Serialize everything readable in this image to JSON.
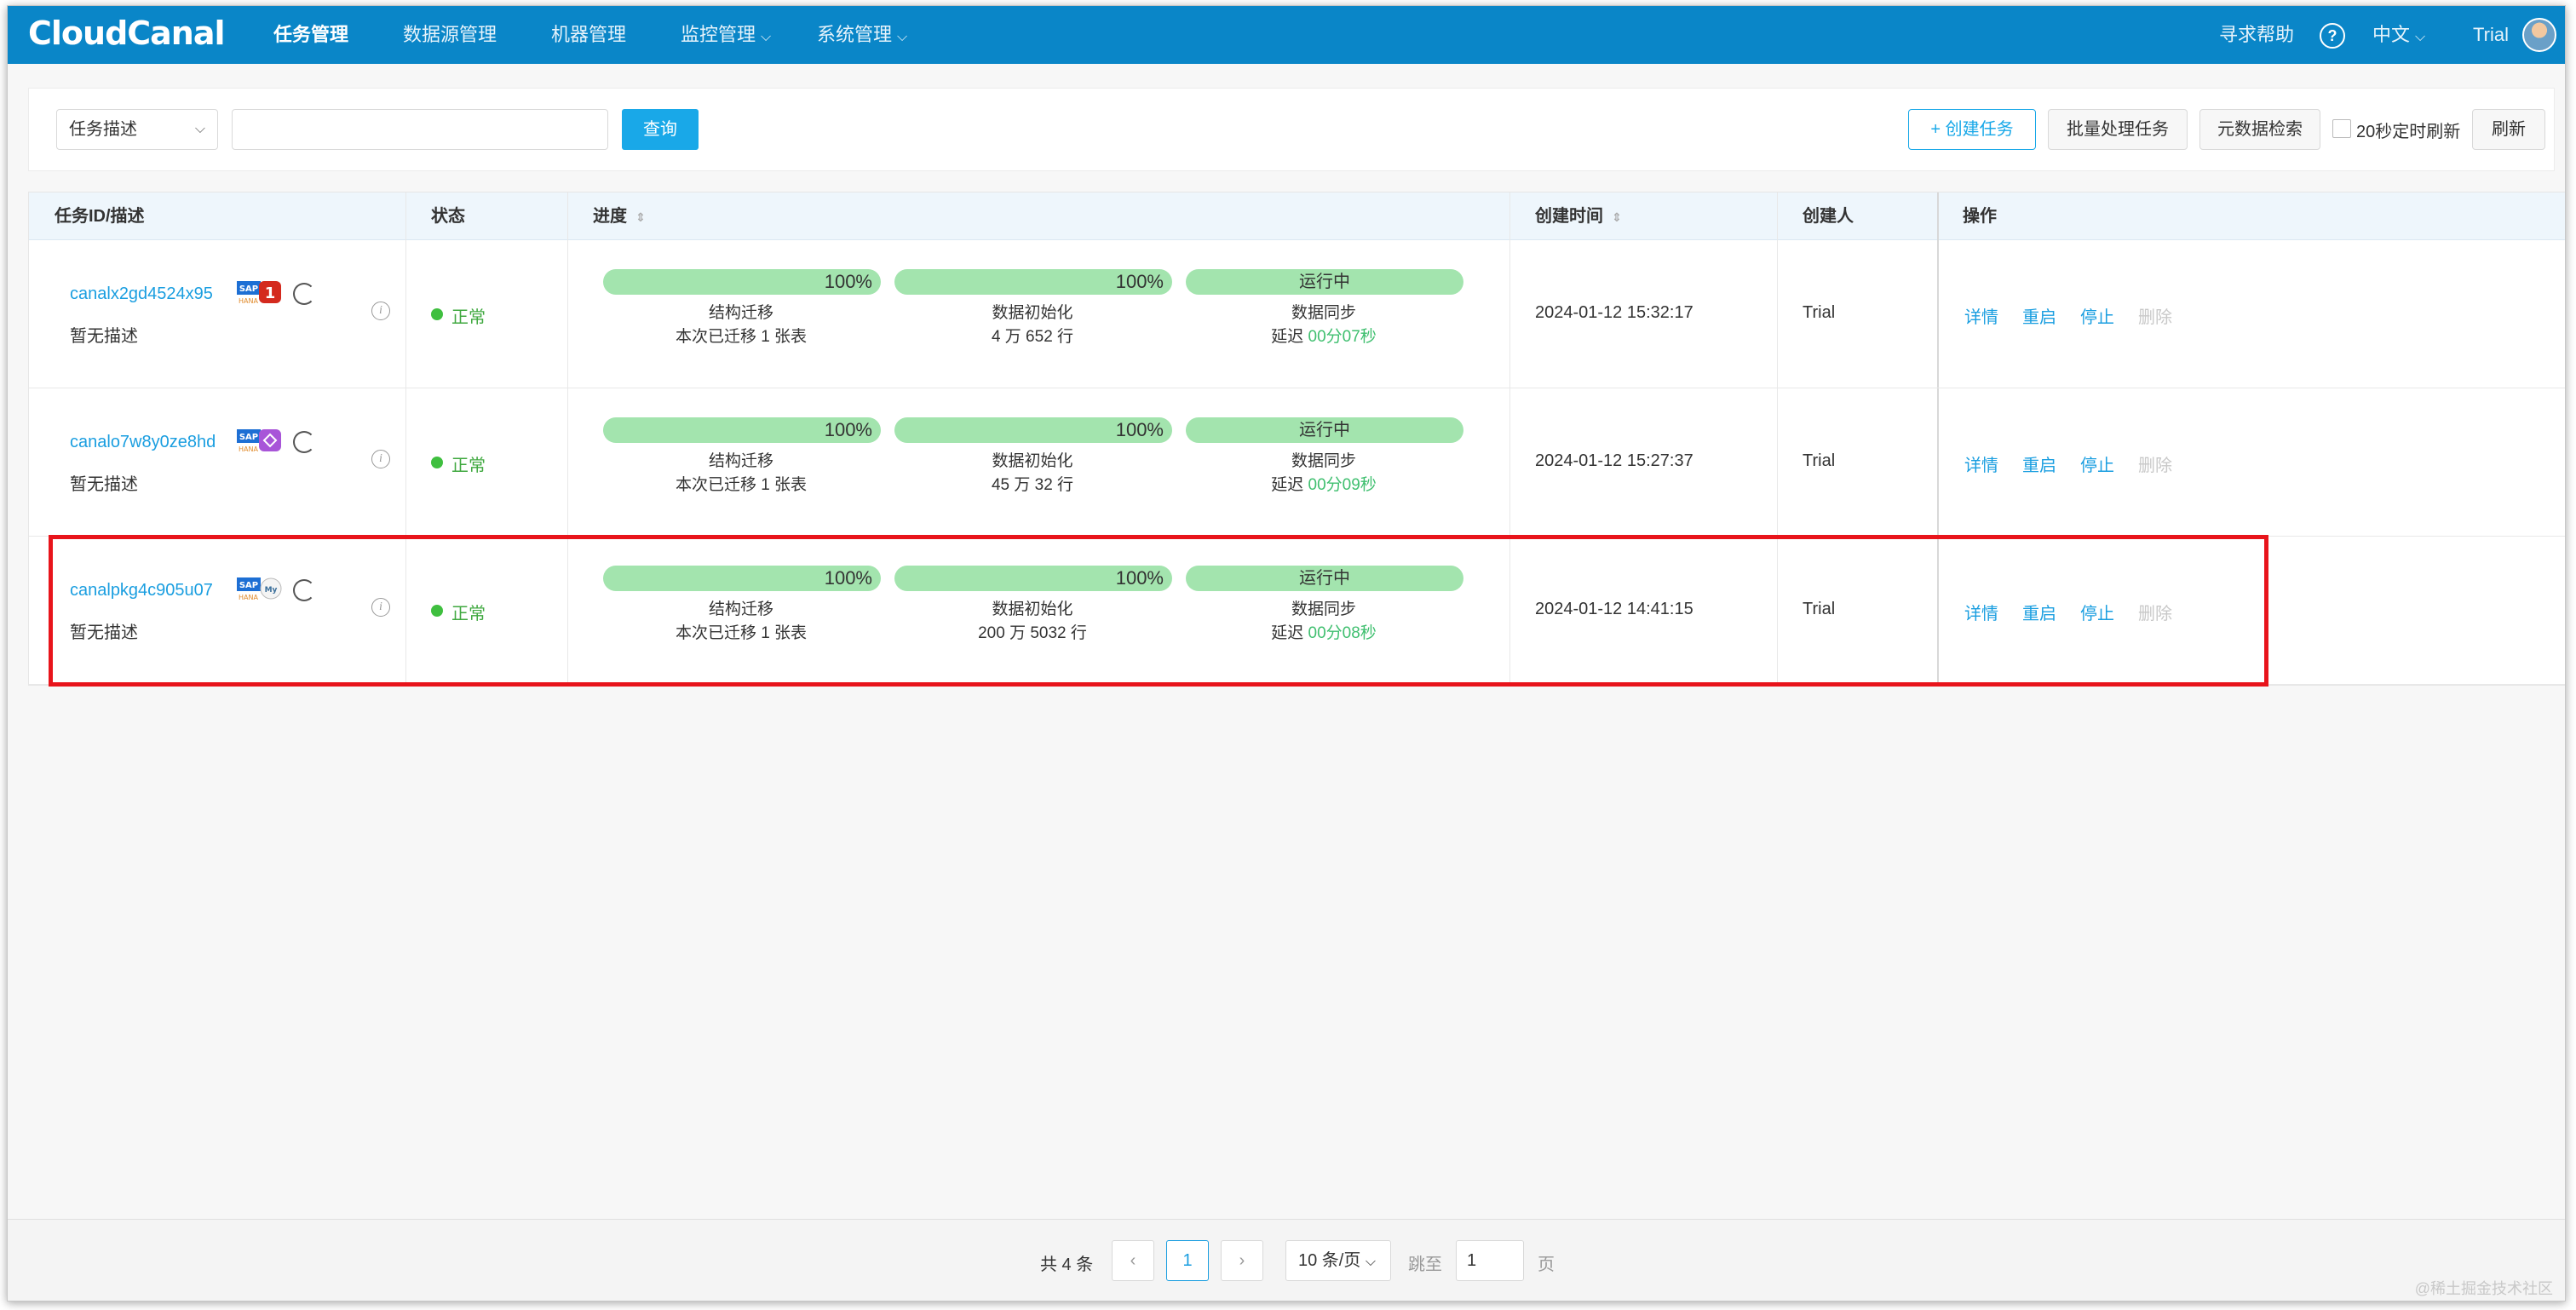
{
  "app": {
    "logo": "CloudCanal"
  },
  "nav": {
    "items": [
      {
        "label": "任务管理",
        "active": true,
        "dropdown": false
      },
      {
        "label": "数据源管理",
        "active": false,
        "dropdown": false
      },
      {
        "label": "机器管理",
        "active": false,
        "dropdown": false
      },
      {
        "label": "监控管理",
        "active": false,
        "dropdown": true
      },
      {
        "label": "系统管理",
        "active": false,
        "dropdown": true
      }
    ],
    "help": "寻求帮助",
    "language": "中文",
    "user": "Trial"
  },
  "filter": {
    "select_value": "任务描述",
    "search_value": "",
    "query_button": "查询",
    "create_button": "+ 创建任务",
    "batch_button": "批量处理任务",
    "meta_search_button": "元数据检索",
    "auto_refresh_label": "20秒定时刷新",
    "auto_refresh_checked": false,
    "refresh_button": "刷新"
  },
  "table": {
    "columns": [
      "任务ID/描述",
      "状态",
      "进度",
      "创建时间",
      "创建人",
      "操作"
    ],
    "rows": [
      {
        "id": "canalx2gd4524x95",
        "desc": "暂无描述",
        "target_db": "red-square",
        "status": "正常",
        "struct_pct": "100%",
        "struct_label": "结构迁移",
        "struct_detail": "本次已迁移 1 张表",
        "init_pct": "100%",
        "init_label": "数据初始化",
        "init_detail": "4 万 652 行",
        "sync_status": "运行中",
        "sync_label": "数据同步",
        "sync_delay_prefix": "延迟",
        "sync_delay": "00分07秒",
        "created": "2024-01-12 15:32:17",
        "creator": "Trial",
        "actions": [
          "详情",
          "重启",
          "停止",
          "删除"
        ]
      },
      {
        "id": "canalo7w8y0ze8hd",
        "desc": "暂无描述",
        "target_db": "purple-square",
        "status": "正常",
        "struct_pct": "100%",
        "struct_label": "结构迁移",
        "struct_detail": "本次已迁移 1 张表",
        "init_pct": "100%",
        "init_label": "数据初始化",
        "init_detail": "45 万 32 行",
        "sync_status": "运行中",
        "sync_label": "数据同步",
        "sync_delay_prefix": "延迟",
        "sync_delay": "00分09秒",
        "created": "2024-01-12 15:27:37",
        "creator": "Trial",
        "actions": [
          "详情",
          "重启",
          "停止",
          "删除"
        ]
      },
      {
        "id": "canalpkg4c905u07",
        "desc": "暂无描述",
        "target_db": "mysql",
        "status": "正常",
        "struct_pct": "100%",
        "struct_label": "结构迁移",
        "struct_detail": "本次已迁移 1 张表",
        "init_pct": "100%",
        "init_label": "数据初始化",
        "init_detail": "200 万 5032 行",
        "sync_status": "运行中",
        "sync_label": "数据同步",
        "sync_delay_prefix": "延迟",
        "sync_delay": "00分08秒",
        "created": "2024-01-12 14:41:15",
        "creator": "Trial",
        "actions": [
          "详情",
          "重启",
          "停止",
          "删除"
        ]
      }
    ]
  },
  "pagination": {
    "total": "共 4 条",
    "prev": "‹",
    "current": "1",
    "next": "›",
    "page_size": "10 条/页",
    "jump_label": "跳至",
    "jump_value": "1",
    "page_suffix": "页"
  },
  "watermark": "@稀土掘金技术社区"
}
